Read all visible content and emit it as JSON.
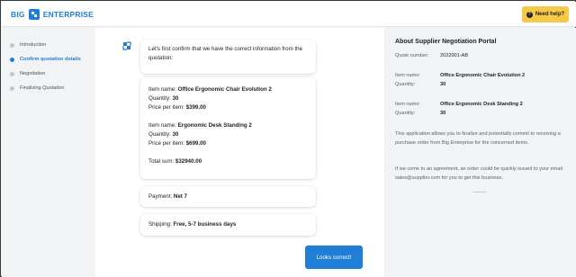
{
  "app": {
    "logo_text_left": "BIG",
    "logo_text_right": "ENTERPRISE",
    "help_label": "Need help?",
    "accent": "#1f7fd6",
    "help_color": "#f7c948"
  },
  "sidebar": {
    "steps": [
      {
        "label": "Introduction",
        "state": "done"
      },
      {
        "label": "Confirm quotation details",
        "state": "active"
      },
      {
        "label": "Negotiation",
        "state": "pending"
      },
      {
        "label": "Finalizing Quotation",
        "state": "pending"
      }
    ]
  },
  "chat": {
    "intro": "Let's first confirm that we have the correct information from the quotation:",
    "items": [
      {
        "name_label": "Item name: ",
        "name": "Office Ergonomic Chair Evolution 2",
        "qty_label": "Quantity: ",
        "qty": "30",
        "price_label": "Price per item: ",
        "price": "$399.00"
      },
      {
        "name_label": "Item name: ",
        "name": "Ergonomic Desk Standing 2",
        "qty_label": "Quantity: ",
        "qty": "30",
        "price_label": "Price per item: ",
        "price": "$699.00"
      }
    ],
    "total_label": "Total sum: ",
    "total": "$32940.00",
    "payment_label": "Payment: ",
    "payment": "Net 7",
    "shipping_label": "Shipping: ",
    "shipping": "Free, 5-7 business days",
    "confirm_button": "Looks correct!"
  },
  "info": {
    "title": "About Supplier Negotiation Portal",
    "quote_label": "Quote number:",
    "quote_value": "2022001-AB",
    "items": [
      {
        "name_label": "Item name:",
        "name": "Office Ergonomic Chair Evolution 2",
        "qty_label": "Quantity:",
        "qty": "30"
      },
      {
        "name_label": "Item name:",
        "name": "Office Ergonomic Desk Standing 2",
        "qty_label": "Quantity:",
        "qty": "30"
      }
    ],
    "paragraph_1": "This application allows you to finalize and potentially commit to receiving a purchase order from Big Enterprise for the concerned items.",
    "paragraph_2": "If we come to an agreement, an order could be quickly issued to your email sales@supplier.com for you to get this business."
  }
}
